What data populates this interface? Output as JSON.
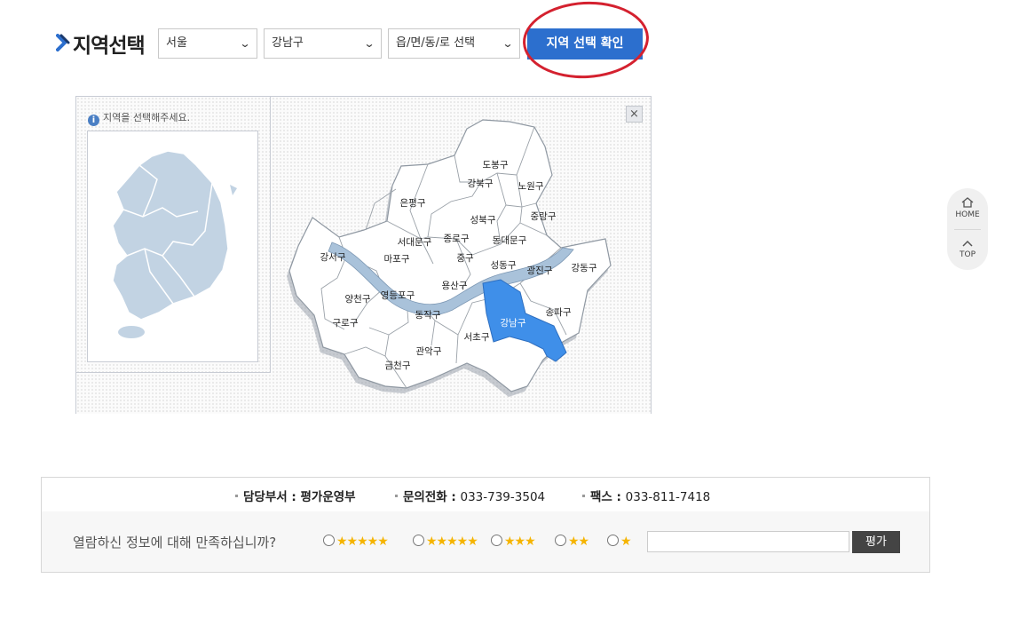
{
  "header": {
    "title": "지역선택",
    "select_city": "서울",
    "select_district": "강남구",
    "select_town": "읍/면/동/로 선택",
    "confirm_label": "지역 선택 확인"
  },
  "map": {
    "info_text": "지역을 선택해주세요.",
    "close_label": "×",
    "selected_district": "강남구",
    "selected_color": "#3f8fe9",
    "district_color": "#ffffff",
    "river_color": "#a9c2da",
    "districts": [
      "도봉구",
      "강북구",
      "노원구",
      "은평구",
      "성북구",
      "중랑구",
      "서대문구",
      "종로구",
      "동대문구",
      "마포구",
      "중구",
      "강서구",
      "성동구",
      "광진구",
      "강동구",
      "용산구",
      "양천구",
      "영등포구",
      "동작구",
      "강남구",
      "송파구",
      "구로구",
      "서초구",
      "관악구",
      "금천구"
    ]
  },
  "floats": {
    "home_label": "HOME",
    "top_label": "TOP"
  },
  "footer": {
    "dept_key": "담당부서 : ",
    "dept_value": "평가운영부",
    "phone_key": "문의전화 : ",
    "phone_value": "033-739-3504",
    "fax_key": "팩스 : ",
    "fax_value": "033-811-7418",
    "question": "열람하신 정보에 대해 만족하십니까?",
    "ratings": [
      "★★★★★",
      "★★★★★",
      "★★★",
      "★★",
      "★"
    ],
    "eval_label": "평가"
  },
  "colors": {
    "accent": "#2c6fce",
    "annotation": "#d4212f",
    "star": "#f5b400",
    "korea_fill": "#c2d3e3"
  }
}
